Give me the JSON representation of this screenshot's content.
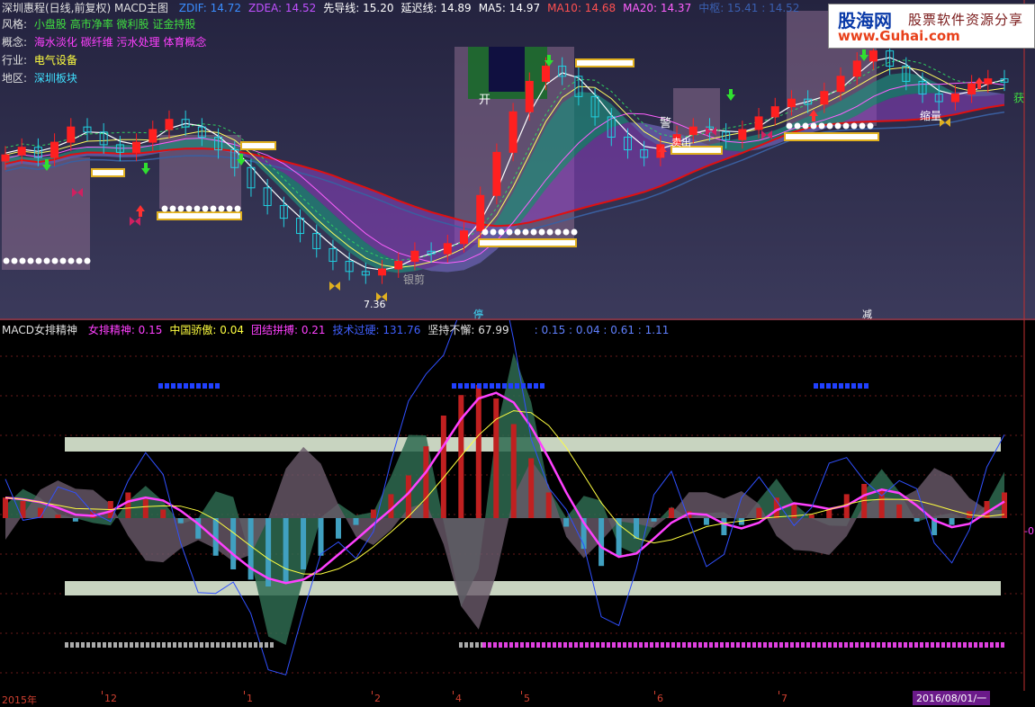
{
  "header": {
    "title": "深圳惠程(日线,前复权) MACD主图",
    "items": [
      {
        "label": "ZDIF: 14.72",
        "color": "#3a8dff"
      },
      {
        "label": "ZDEA: 14.52",
        "color": "#c050ff"
      },
      {
        "label": "先导线: 15.20",
        "color": "#ffffff"
      },
      {
        "label": "延迟线: 14.89",
        "color": "#ffffff"
      },
      {
        "label": "MA5: 14.97",
        "color": "#ffffff"
      },
      {
        "label": "MA10: 14.68",
        "color": "#ff5050"
      },
      {
        "label": "MA20: 14.37",
        "color": "#ff60ff"
      },
      {
        "label": "中枢: 15.41 : 14.52",
        "color": "#3a5fb0"
      }
    ]
  },
  "info": {
    "style_label": "风格:",
    "style_value": "小盘股 高市净率 微利股 证金持股",
    "concept_label": "概念:",
    "concept_value": "海水淡化 碳纤维 污水处理 体育概念",
    "industry_label": "行业:",
    "industry_value": "电气设备",
    "region_label": "地区:",
    "region_value": "深圳板块"
  },
  "logo": {
    "brand": "股海网",
    "tagline": "股票软件资源分享",
    "site": "www.Guhai.com"
  },
  "upper_annotations": {
    "open": "开",
    "warn": "警",
    "sell": "卖出",
    "shrink": "缩量",
    "buy": "获",
    "cut": "银剪",
    "low_price": "7.36",
    "stop": "停",
    "red_reduce": "减"
  },
  "lower_header": {
    "title": "MACD女排精神",
    "items": [
      {
        "label": "女排精神: 0.15",
        "color": "#ff40ff"
      },
      {
        "label": "中国骄傲: 0.04",
        "color": "#ffff40"
      },
      {
        "label": "团结拼搏: 0.21",
        "color": "#ff40ff"
      },
      {
        "label": "技术过硬: 131.76",
        "color": "#4060ff"
      },
      {
        "label": "坚持不懈: 67.99",
        "color": "#e0e0e0"
      },
      {
        "label": ": 0.15 : 0.04 : 0.61 : 1.11",
        "color": "#6080ff"
      }
    ],
    "zero_label": "-0"
  },
  "time_axis": {
    "labels": [
      "2015年",
      "12",
      "1",
      "2",
      "4",
      "5",
      "6",
      "7"
    ],
    "current": "2016/08/01/一"
  },
  "colors": {
    "upper_bg": "#2e2d4b",
    "candle_up": "#ff2020",
    "candle_down": "#20d0e0",
    "ma_long": "#e01010",
    "ribbon_green": "#1f8a7a",
    "ribbon_purple": "#8a40c0",
    "macd_up": "#c02020",
    "macd_down": "#40a0c0",
    "band": "#c8d4c0"
  },
  "chart_data": {
    "type": "line",
    "price_series_close": [
      12.1,
      12.4,
      12.0,
      12.6,
      13.2,
      13.0,
      12.5,
      12.2,
      12.6,
      13.1,
      13.5,
      13.2,
      12.8,
      12.3,
      11.6,
      10.8,
      10.1,
      9.6,
      9.0,
      8.4,
      7.9,
      7.5,
      7.36,
      7.6,
      7.9,
      8.3,
      8.2,
      8.6,
      9.1,
      10.5,
      12.2,
      13.8,
      15.0,
      15.6,
      15.2,
      14.4,
      13.6,
      12.8,
      12.3,
      12.0,
      12.5,
      12.9,
      13.2,
      13.0,
      12.7,
      13.1,
      13.6,
      14.0,
      14.3,
      14.1,
      14.6,
      15.2,
      15.8,
      16.2,
      15.6,
      15.0,
      14.5,
      14.2,
      14.5,
      14.9,
      15.1,
      14.97
    ],
    "price_ylim": [
      6.5,
      17.5
    ],
    "macd_series": [
      0.12,
      0.1,
      0.06,
      0.02,
      -0.02,
      0.04,
      0.1,
      0.15,
      0.11,
      0.05,
      -0.03,
      -0.12,
      -0.22,
      -0.3,
      -0.36,
      -0.4,
      -0.38,
      -0.3,
      -0.22,
      -0.12,
      -0.04,
      0.05,
      0.14,
      0.25,
      0.42,
      0.6,
      0.72,
      0.78,
      0.7,
      0.55,
      0.35,
      0.15,
      -0.05,
      -0.18,
      -0.28,
      -0.22,
      -0.12,
      -0.02,
      0.06,
      0.04,
      -0.04,
      -0.1,
      -0.04,
      0.06,
      0.12,
      0.08,
      0.02,
      0.06,
      0.14,
      0.2,
      0.16,
      0.08,
      -0.02,
      -0.1,
      -0.04,
      0.04,
      0.1,
      0.15
    ],
    "macd_ylim": [
      -1.0,
      1.0
    ]
  }
}
